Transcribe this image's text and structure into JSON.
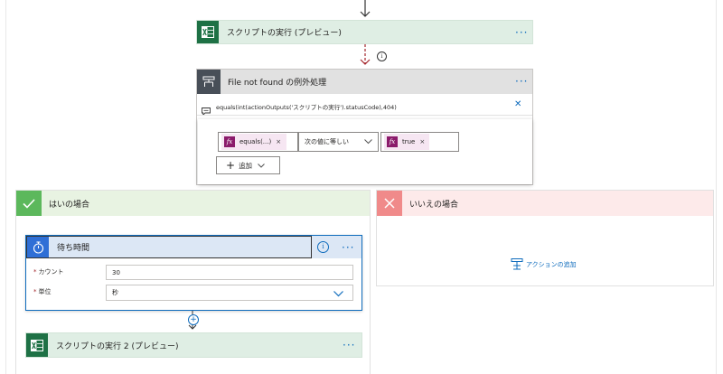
{
  "top_action": {
    "title": "スクリプトの実行 (プレビュー)",
    "more": "···",
    "icon": "excel-icon"
  },
  "connector": {
    "info_icon": "info-icon"
  },
  "scope": {
    "title": "File not found の例外処理",
    "more": "···",
    "icon": "condition-icon",
    "expression": "equals(int(actionOutputs('スクリプトの実行').statusCode),404)",
    "close": "✕"
  },
  "condition_row": {
    "left_pill": "equals(...)",
    "operator": "次の値に等しい",
    "right_pill": "true",
    "remove": "×",
    "fx": "fx",
    "add_label": "追加"
  },
  "yes_branch": {
    "title": "はいの場合",
    "delay": {
      "title": "待ち時間",
      "more": "···",
      "count_label": "カウント",
      "count_value": "30",
      "unit_label": "単位",
      "unit_value": "秒"
    },
    "next_action": {
      "title": "スクリプトの実行 2 (プレビュー)",
      "more": "···"
    }
  },
  "no_branch": {
    "title": "いいえの場合",
    "add_action": "アクションの追加"
  },
  "colors": {
    "excel_green": "#1e7145",
    "scope_dark": "#484f58",
    "yes_green": "#5cb85c",
    "no_red": "#f08a8a",
    "accent_blue": "#0f6cbd",
    "pill_bg": "#f6e6f2",
    "fx_purple": "#8b1a6b"
  }
}
